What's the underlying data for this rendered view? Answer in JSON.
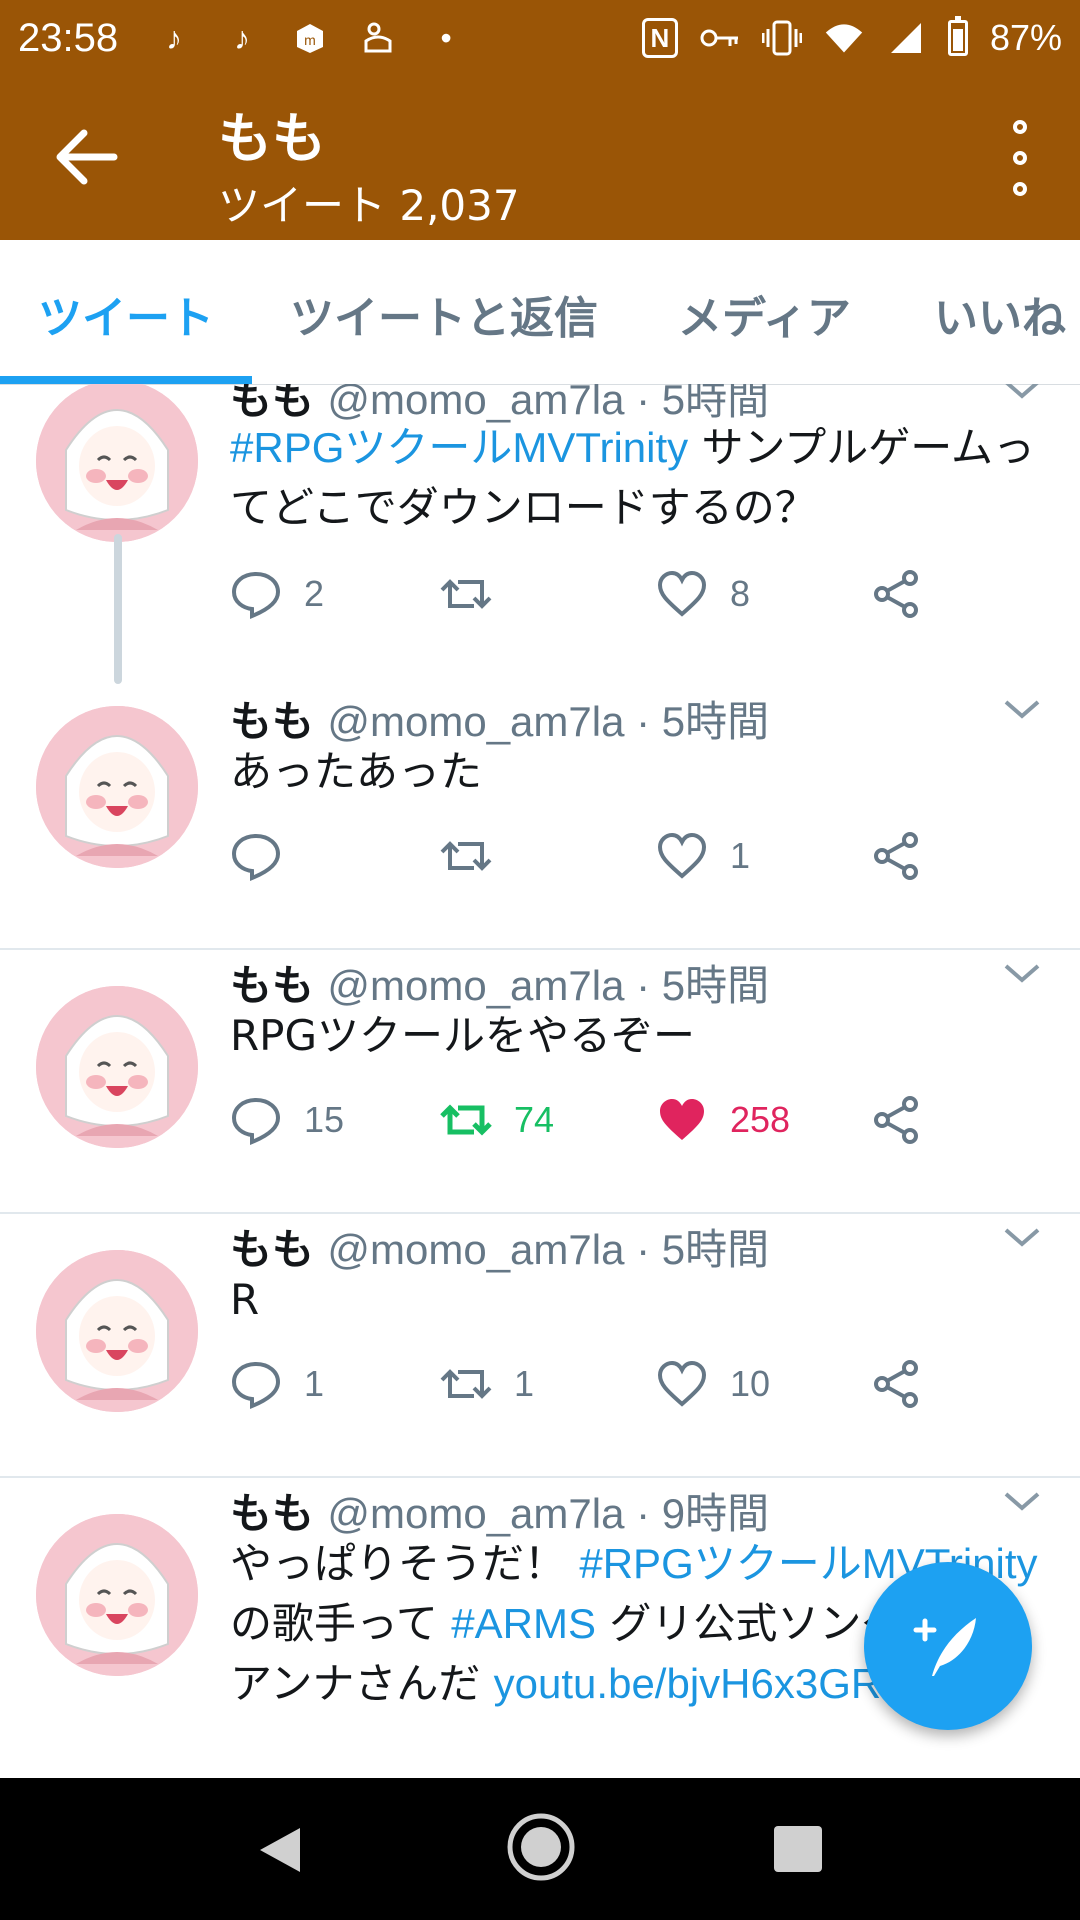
{
  "status_bar": {
    "time": "23:58",
    "battery": "87%",
    "left_icons": [
      "tiktok-icon",
      "tiktok-icon",
      "mercari-icon",
      "game-icon",
      "dot-icon"
    ],
    "right_icons": [
      "nfc-icon",
      "vpn-key-icon",
      "vibrate-icon",
      "wifi-icon",
      "signal-icon",
      "battery-icon"
    ]
  },
  "header": {
    "name": "もも",
    "subtitle": "ツイート 2,037"
  },
  "tabs": [
    {
      "label": "ツイート",
      "active": true
    },
    {
      "label": "ツイートと返信",
      "active": false
    },
    {
      "label": "メディア",
      "active": false
    },
    {
      "label": "いいね",
      "active": false
    }
  ],
  "tweets": [
    {
      "name": "もも",
      "meta": "@momo_am7la · 5時間",
      "body": [
        {
          "text": "#RPGツクールMVTrinity",
          "link": true
        },
        {
          "text": " サンプルゲームってどこでダウンロードするの？",
          "link": false
        }
      ],
      "reply_count": "2",
      "retweet_count": "",
      "like_count": "8"
    },
    {
      "name": "もも",
      "meta": "@momo_am7la · 5時間",
      "body": [
        {
          "text": "あったあった",
          "link": false
        }
      ],
      "reply_count": "",
      "retweet_count": "",
      "like_count": "1"
    },
    {
      "name": "もも",
      "meta": "@momo_am7la · 5時間",
      "body": [
        {
          "text": "RPGツクールをやるぞー",
          "link": false
        }
      ],
      "reply_count": "15",
      "retweet_count": "74",
      "like_count": "258"
    },
    {
      "name": "もも",
      "meta": "@momo_am7la · 5時間",
      "body": [
        {
          "text": "R",
          "link": false
        }
      ],
      "reply_count": "1",
      "retweet_count": "1",
      "like_count": "10"
    },
    {
      "name": "もも",
      "meta": "@momo_am7la · 9時間",
      "body": [
        {
          "text": "やっぱりそうだ！ ",
          "link": false
        },
        {
          "text": "#RPGツクールMVTrinity",
          "link": true
        },
        {
          "text": " の歌手って ",
          "link": false
        },
        {
          "text": "#ARMS",
          "link": true
        },
        {
          "text": " グリ公式ソングのエリアンナさんだ ",
          "link": false
        },
        {
          "text": "youtu.be/bjvH6x3GRZI",
          "link": true
        }
      ]
    }
  ],
  "colors": {
    "brand_bar": "#9a5506",
    "accent": "#1da1f2",
    "retweet_active": "#17bf63",
    "like_active": "#e0245e",
    "secondary_text": "#657786"
  }
}
